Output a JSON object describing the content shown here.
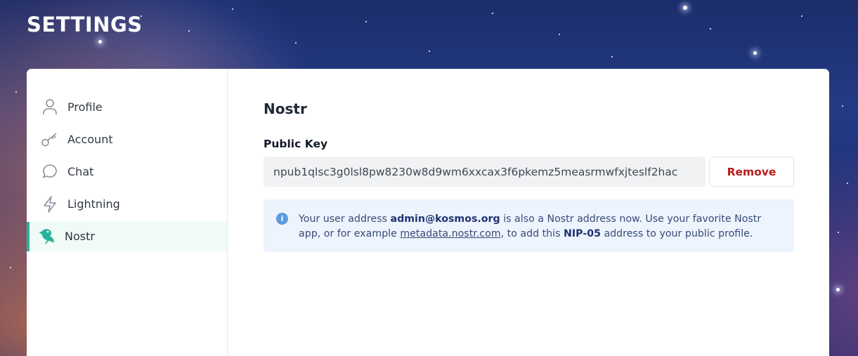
{
  "page": {
    "title": "SETTINGS"
  },
  "sidebar": {
    "items": [
      {
        "label": "Profile",
        "icon": "user-icon"
      },
      {
        "label": "Account",
        "icon": "key-icon"
      },
      {
        "label": "Chat",
        "icon": "chat-bubble-icon"
      },
      {
        "label": "Lightning",
        "icon": "lightning-bolt-icon"
      },
      {
        "label": "Nostr",
        "icon": "nostr-ostrich-icon",
        "active": true
      }
    ]
  },
  "main": {
    "title": "Nostr",
    "public_key": {
      "label": "Public Key",
      "value": "npub1qlsc3g0lsl8pw8230w8d9wm6xxcax3f6pkemz5measrmwfxjteslf2hac"
    },
    "remove_label": "Remove",
    "info": {
      "text_1": "Your user address",
      "address": "admin@kosmos.org",
      "text_2": "is also a Nostr address now. Use your favorite Nostr app, or for example",
      "link": "metadata.nostr.com",
      "text_3": ", to add this",
      "nip": "NIP-05",
      "text_4": "address to your public profile."
    }
  },
  "colors": {
    "accent": "#2bb39a",
    "danger": "#b91c1c",
    "info_bg": "#edf4fd"
  }
}
